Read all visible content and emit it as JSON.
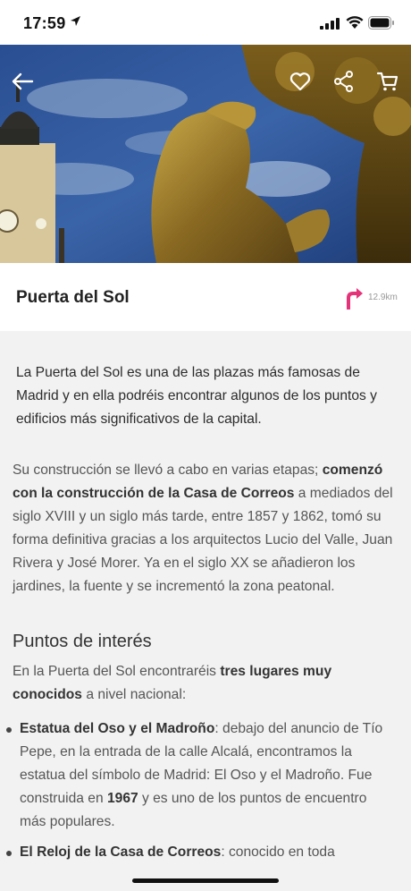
{
  "status_bar": {
    "time": "17:59"
  },
  "header": {
    "back_icon": "arrow-left-icon",
    "actions": [
      "heart-icon",
      "share-icon",
      "cart-icon"
    ]
  },
  "place": {
    "title": "Puerta del Sol",
    "distance": "12.9km",
    "accent_color": "#e5337a"
  },
  "content": {
    "intro": "La Puerta del Sol es una de las plazas más famosas de Madrid y en ella podréis encontrar algunos de los puntos y edificios más significativos de la capital.",
    "body_1": "Su construcción se llevó a cabo en varias etapas; ",
    "body_1_bold": "comenzó con la construcción de la Casa de Correos",
    "body_1_rest": " a mediados del siglo XVIII y un siglo más tarde, entre 1857 y 1862, tomó su forma definitiva gracias a los arquitectos Lucio del Valle, Juan Rivera y José Morer. Ya en el siglo XX se añadieron los jardines, la fuente y se incrementó la zona peatonal.",
    "section_heading": "Puntos de interés",
    "section_intro_1": "En la Puerta del Sol encontraréis ",
    "section_intro_bold": "tres lugares muy conocidos",
    "section_intro_2": " a nivel nacional:",
    "poi": [
      {
        "title": "Estatua del Oso y el Madroño",
        "text_1": ": debajo del anuncio de Tío Pepe, en la entrada de la calle Alcalá, encontramos la estatua del símbolo de Madrid: El Oso y el Madroño. Fue construida en ",
        "text_bold": "1967",
        "text_2": " y es uno de los puntos de encuentro más populares."
      },
      {
        "title": "El Reloj de la Casa de Correos",
        "text_1": ": conocido en toda",
        "text_bold": "",
        "text_2": ""
      }
    ]
  }
}
